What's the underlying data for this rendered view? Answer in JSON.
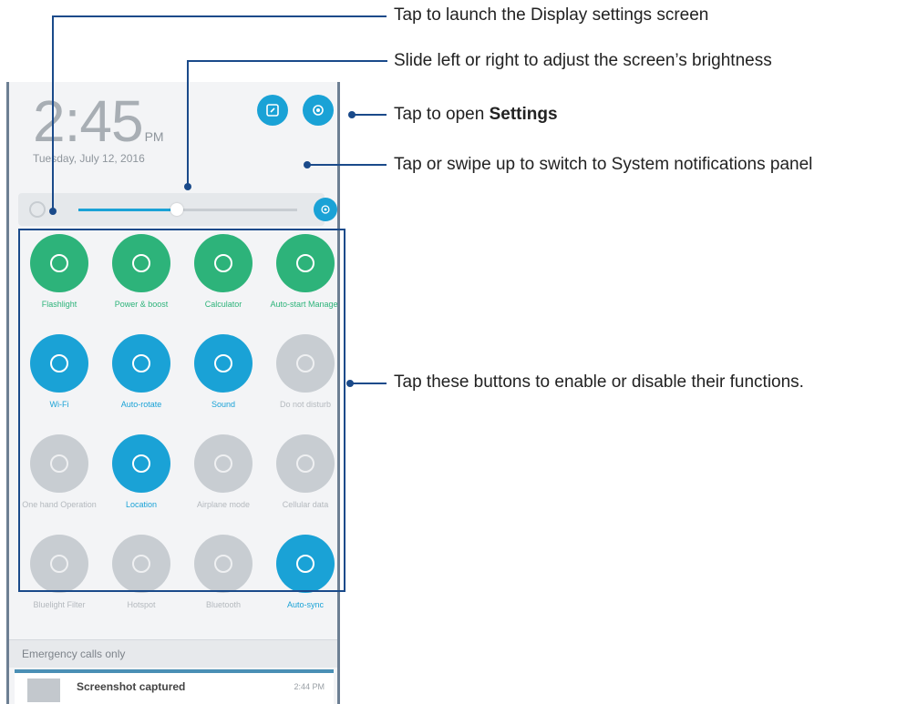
{
  "clock": {
    "time": "2:45",
    "ampm": "PM",
    "date": "Tuesday, July 12, 2016"
  },
  "colors": {
    "accent": "#1aa2d6",
    "active_tile": "#2db37a",
    "inactive_tile": "#c8cdd2",
    "callout_line": "#1a4a8a"
  },
  "brightness": {
    "level_percent": 45
  },
  "tiles": [
    {
      "label": "Flashlight",
      "icon": "flashlight-icon",
      "state": "on-green"
    },
    {
      "label": "Power & boost",
      "icon": "boost-icon",
      "state": "on-green"
    },
    {
      "label": "Calculator",
      "icon": "calculator-icon",
      "state": "on-green"
    },
    {
      "label": "Auto-start Manager",
      "icon": "gear-icon",
      "state": "on-green"
    },
    {
      "label": "Wi-Fi",
      "icon": "wifi-icon",
      "state": "on-blue"
    },
    {
      "label": "Auto-rotate",
      "icon": "rotate-icon",
      "state": "on-blue"
    },
    {
      "label": "Sound",
      "icon": "sound-icon",
      "state": "on-blue"
    },
    {
      "label": "Do not disturb",
      "icon": "moon-icon",
      "state": "off"
    },
    {
      "label": "One hand Operation",
      "icon": "one-hand-icon",
      "state": "off"
    },
    {
      "label": "Location",
      "icon": "location-icon",
      "state": "on-blue"
    },
    {
      "label": "Airplane mode",
      "icon": "airplane-icon",
      "state": "off"
    },
    {
      "label": "Cellular data",
      "icon": "data-icon",
      "state": "off"
    },
    {
      "label": "Bluelight Filter",
      "icon": "bluelight-icon",
      "state": "off"
    },
    {
      "label": "Hotspot",
      "icon": "hotspot-icon",
      "state": "off"
    },
    {
      "label": "Bluetooth",
      "icon": "bluetooth-icon",
      "state": "off"
    },
    {
      "label": "Auto-sync",
      "icon": "sync-icon",
      "state": "on-blue"
    }
  ],
  "status": {
    "emergency": "Emergency calls only"
  },
  "notification": {
    "title": "Screenshot captured",
    "time": "2:44 PM"
  },
  "callouts": {
    "display_settings": "Tap to launch the Display settings screen",
    "brightness": "Slide left or right to adjust the screen’s brightness",
    "settings_prefix": "Tap to open ",
    "settings_bold": "Settings",
    "system_panel": "Tap or swipe up to switch to System notifications panel",
    "buttons": "Tap these buttons to enable or disable their functions."
  }
}
